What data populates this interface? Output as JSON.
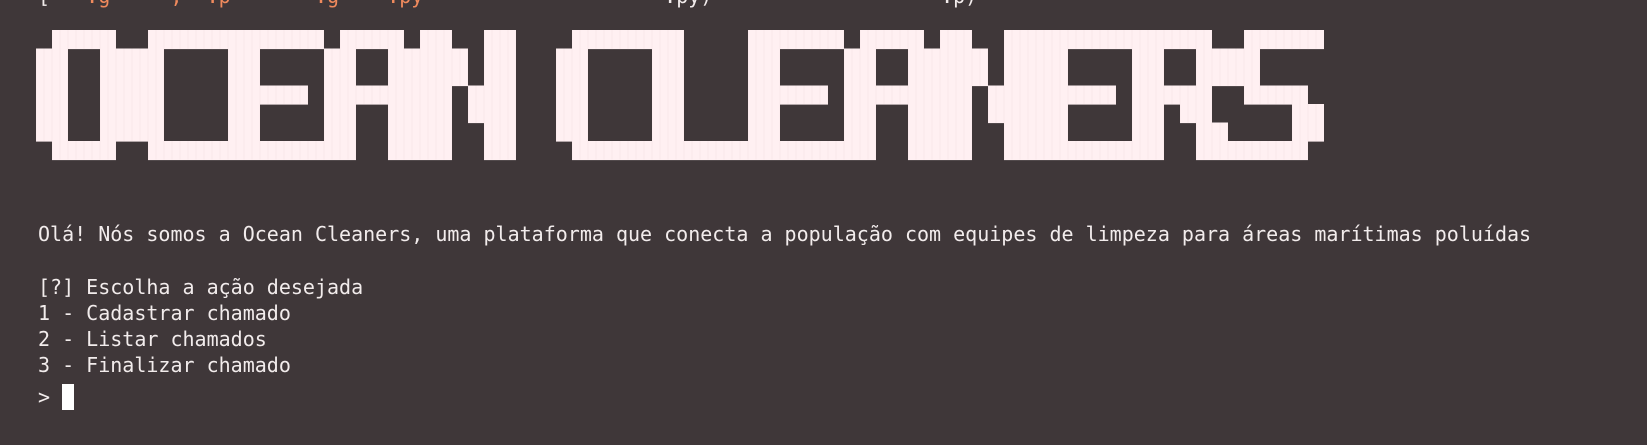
{
  "terminal": {
    "previous_output": {
      "white_start": "[",
      "orange_part": "   .g     ,  .p       .g    .py",
      "white_end": "                    .py)                   .p)"
    },
    "banner_text": "OCEAN CLEANERS",
    "welcome_message": "Olá! Nós somos a Ocean Cleaners, uma plataforma que conecta a população com equipes de limpeza para áreas marítimas poluídas",
    "menu": {
      "question": "[?] Escolha a ação desejada",
      "options": [
        "1 - Cadastrar chamado",
        "2 - Listar chamados",
        "3 - Finalizar chamado"
      ]
    },
    "prompt_symbol": ">"
  },
  "colors": {
    "background": "#3f3739",
    "text": "#f2ecec",
    "banner_fill": "#fff0f2",
    "banner_grid": "#ead7db",
    "accent_orange": "#f08a5d",
    "cursor": "#ffffff"
  }
}
